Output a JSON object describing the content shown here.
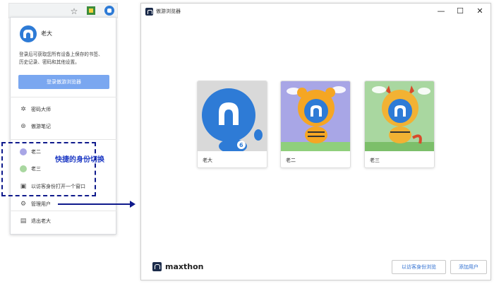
{
  "browser_toolbar": {
    "icons": [
      "star-icon",
      "extension-icon",
      "profile-icon"
    ]
  },
  "profile_menu": {
    "current_user": "老大",
    "login_prompt": "登录后可获取您所有设备上保存的书签、历史记录、密码和其他设置。",
    "login_button": "登录傲游浏览器",
    "items": [
      {
        "label": "密码大师",
        "icon": "password-icon"
      },
      {
        "label": "傲游笔记",
        "icon": "notes-icon"
      },
      {
        "label": "老二",
        "icon": "tiger-avatar-icon"
      },
      {
        "label": "老三",
        "icon": "dragon-avatar-icon"
      },
      {
        "label": "以访客身份打开一个窗口",
        "icon": "guest-icon"
      },
      {
        "label": "管理用户",
        "icon": "gear-icon"
      },
      {
        "label": "退出老大",
        "icon": "exit-icon"
      }
    ]
  },
  "annotation": {
    "text": "快捷的身份切换",
    "color": "#1d39c4"
  },
  "profile_window": {
    "title": "傲游浏览器",
    "controls": [
      "minimize-icon",
      "maximize-icon",
      "close-icon"
    ],
    "profiles": [
      {
        "name": "老大",
        "avatar": "blue-mascot-avatar"
      },
      {
        "name": "老二",
        "avatar": "tiger-avatar"
      },
      {
        "name": "老三",
        "avatar": "dragon-avatar"
      }
    ],
    "brand": "maxthon",
    "guest_button": "以访客身份浏览",
    "add_button": "添加用户"
  },
  "colors": {
    "accent": "#2f6fd1",
    "login_button": "#7aa7f0",
    "mascot_blue": "#2e7bd6",
    "annotation_border": "#0f1a8c"
  }
}
